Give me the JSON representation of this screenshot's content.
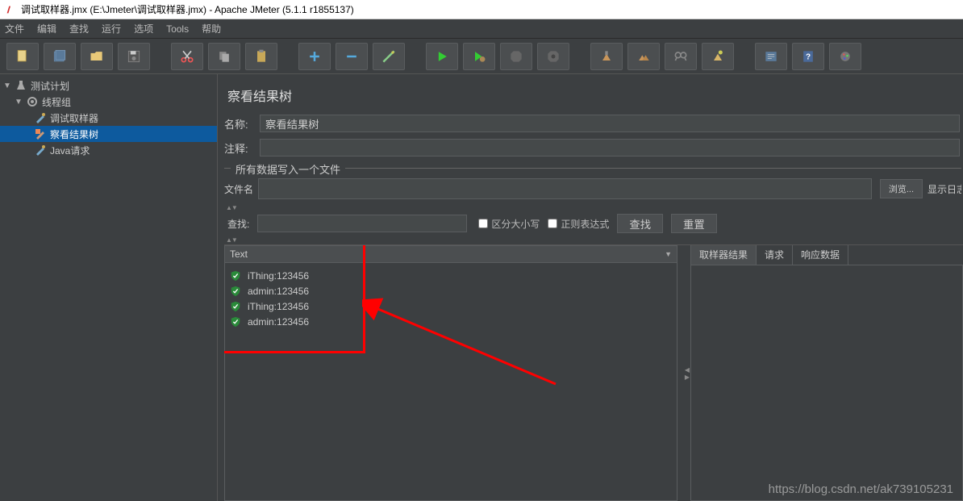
{
  "window": {
    "title": "调试取样器.jmx (E:\\Jmeter\\调试取样器.jmx) - Apache JMeter (5.1.1 r1855137)"
  },
  "menu": {
    "items": [
      "文件",
      "编辑",
      "查找",
      "运行",
      "选项",
      "Tools",
      "帮助"
    ]
  },
  "tree": {
    "root": "测试计划",
    "group": "线程组",
    "nodes": [
      "调试取样器",
      "察看结果树",
      "Java请求"
    ],
    "selected_index": 1
  },
  "panel": {
    "title": "察看结果树",
    "name_label": "名称:",
    "name_value": "察看结果树",
    "comment_label": "注释:",
    "comment_value": "",
    "file_section": "所有数据写入一个文件",
    "filename_label": "文件名",
    "filename_value": "",
    "browse": "浏览...",
    "show_log": "显示日志",
    "search_label": "查找:",
    "search_value": "",
    "case_label": "区分大小写",
    "regex_label": "正则表达式",
    "search_btn": "查找",
    "reset_btn": "重置",
    "dropdown": "Text",
    "results": [
      "iThing:123456",
      "admin:123456",
      "iThing:123456",
      "admin:123456"
    ],
    "tabs": [
      "取样器结果",
      "请求",
      "响应数据"
    ]
  },
  "watermark": "https://blog.csdn.net/ak739105231"
}
